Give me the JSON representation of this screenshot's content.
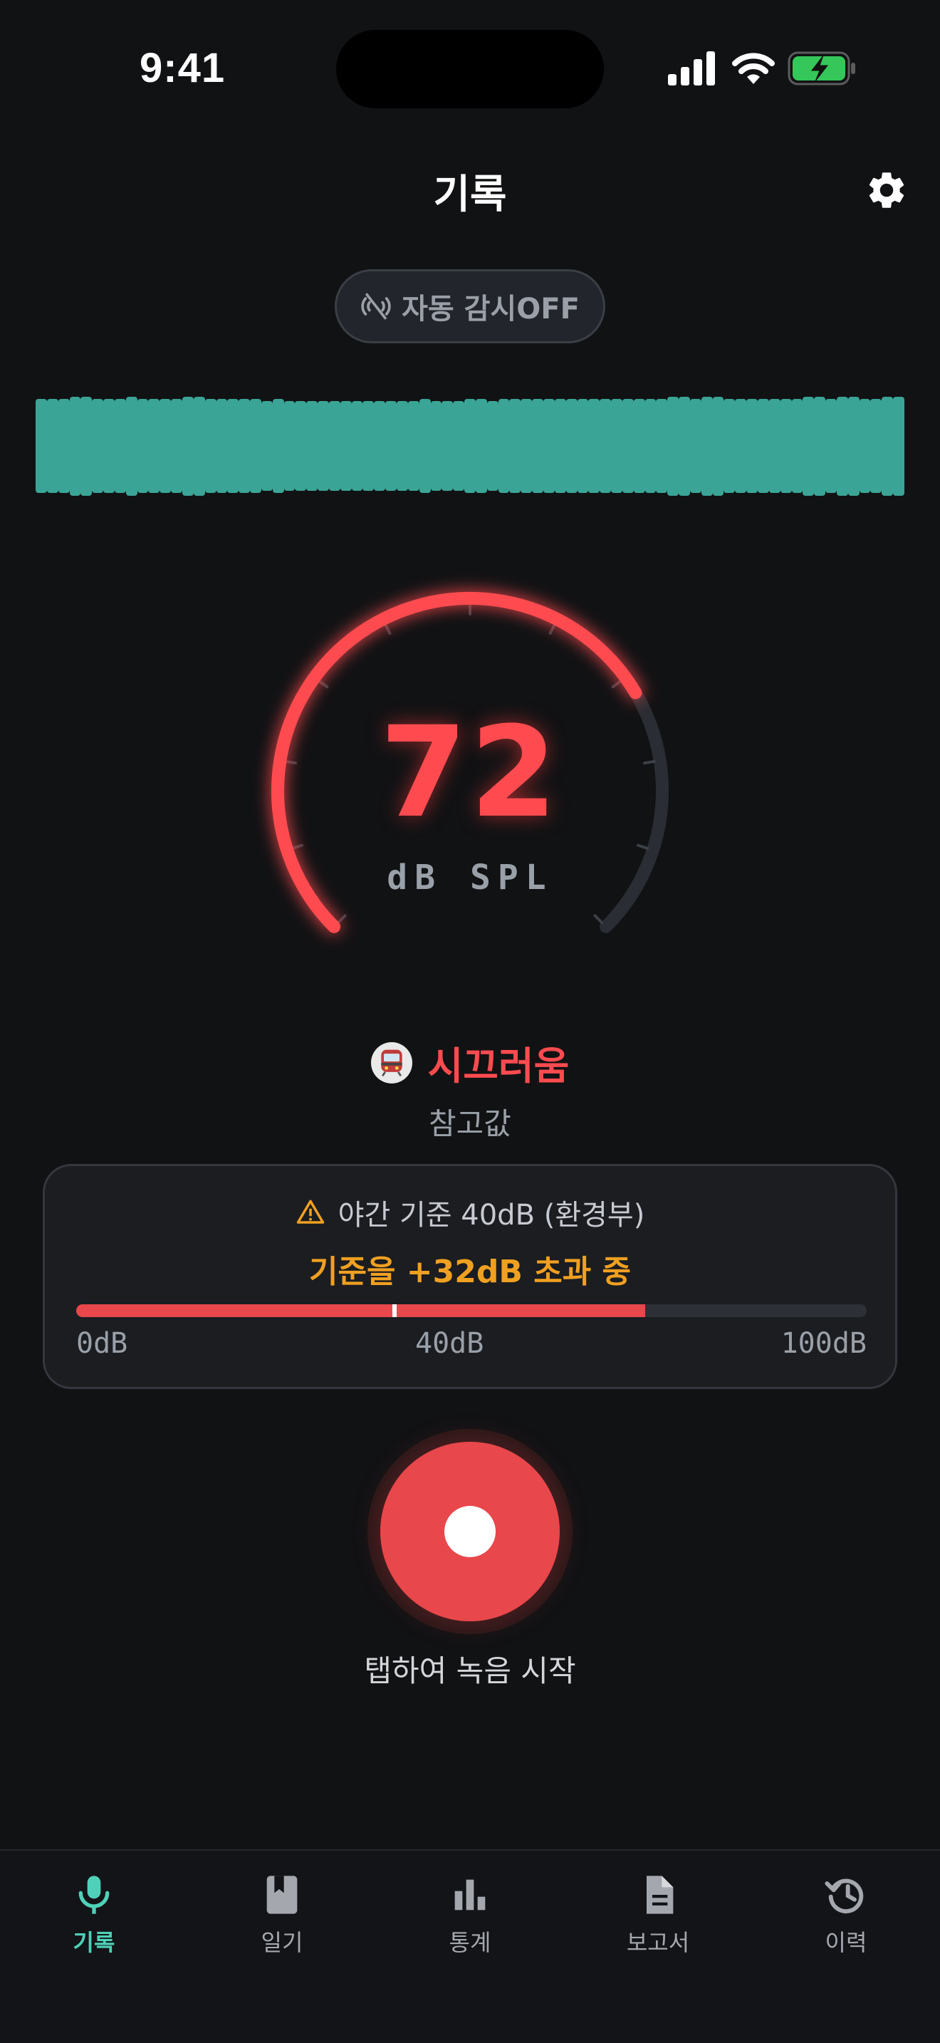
{
  "status_bar": {
    "time": "9:41"
  },
  "header": {
    "title": "기록",
    "settings_icon": "gear-icon"
  },
  "auto_monitor": {
    "label": "자동 감시OFF",
    "icon": "sensor-off-icon"
  },
  "waveform": {
    "color": "#3aa596",
    "levels": [
      0.94,
      0.94,
      0.94,
      0.99,
      0.99,
      0.94,
      0.94,
      0.94,
      0.99,
      0.94,
      0.94,
      0.94,
      0.94,
      0.99,
      0.99,
      0.94,
      0.94,
      0.94,
      0.94,
      0.94,
      0.9,
      0.94,
      0.9,
      0.9,
      0.9,
      0.9,
      0.9,
      0.9,
      0.9,
      0.9,
      0.9,
      0.9,
      0.9,
      0.9,
      0.94,
      0.9,
      0.9,
      0.9,
      0.94,
      0.94,
      0.9,
      0.94,
      0.94,
      0.94,
      0.94,
      0.94,
      0.94,
      0.94,
      0.94,
      0.94,
      0.94,
      0.94,
      0.94,
      0.94,
      0.94,
      0.94,
      0.99,
      0.99,
      0.94,
      0.99,
      0.99,
      0.94,
      0.94,
      0.94,
      0.94,
      0.94,
      0.94,
      0.94,
      0.99,
      0.99,
      0.94,
      0.99,
      0.99,
      0.94,
      0.94,
      0.99,
      0.99
    ]
  },
  "gauge": {
    "value": "72",
    "unit": "dB SPL",
    "fraction": 0.72,
    "color": "#ff4b4f"
  },
  "noise_level": {
    "icon": "train-icon",
    "label": "시끄러움",
    "sub_label": "참고값"
  },
  "standard": {
    "title": "야간 기준 40dB (환경부)",
    "exceed_text": "기준을 +32dB 초과 중",
    "current_fraction": 0.72,
    "threshold_fraction": 0.4,
    "tick_min": "0dB",
    "tick_mid": "40dB",
    "tick_max": "100dB",
    "warning_icon": "warning-icon"
  },
  "record": {
    "label": "탭하여 녹음 시작"
  },
  "tabs": [
    {
      "label": "기록",
      "icon": "mic-icon",
      "active": true
    },
    {
      "label": "일기",
      "icon": "bookmark-book-icon",
      "active": false
    },
    {
      "label": "통계",
      "icon": "bar-chart-icon",
      "active": false
    },
    {
      "label": "보고서",
      "icon": "document-icon",
      "active": false
    },
    {
      "label": "이력",
      "icon": "history-icon",
      "active": false
    }
  ],
  "colors": {
    "accent": "#4fd1b9",
    "danger": "#e8474b",
    "warning": "#f0a020",
    "background": "#111214"
  }
}
